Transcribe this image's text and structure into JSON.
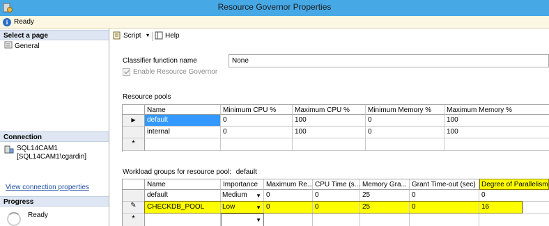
{
  "window": {
    "title": "Resource Governor Properties"
  },
  "status": {
    "text": "Ready"
  },
  "sidebar": {
    "select_page_header": "Select a page",
    "pages": [
      {
        "label": "General"
      }
    ],
    "connection_header": "Connection",
    "connection_server": "SQL14CAM1",
    "connection_user": "[SQL14CAM1\\cgardin]",
    "view_connection_link": "View connection properties",
    "progress_header": "Progress",
    "progress_status": "Ready"
  },
  "toolbar": {
    "script_label": "Script",
    "help_label": "Help"
  },
  "form": {
    "classifier_label": "Classifier function name",
    "classifier_value": "None",
    "enable_label": "Enable Resource Governor",
    "pools_label": "Resource pools",
    "workload_label": "Workload groups for resource pool:",
    "workload_pool_name": "default"
  },
  "pools_grid": {
    "headers": [
      "Name",
      "Minimum CPU %",
      "Maximum CPU %",
      "Minimum Memory %",
      "Maximum Memory %"
    ],
    "rows": [
      [
        "default",
        "0",
        "100",
        "0",
        "100"
      ],
      [
        "internal",
        "0",
        "100",
        "0",
        "100"
      ],
      [
        "",
        "",
        "",
        "",
        ""
      ]
    ],
    "row_markers": [
      "▶",
      "",
      "*"
    ]
  },
  "workload_grid": {
    "headers": [
      "Name",
      "Importance",
      "Maximum Re...",
      "CPU Time (s...",
      "Memory Gra...",
      "Grant Time-out (sec)",
      "Degree of Parallelism"
    ],
    "rows": [
      [
        "default",
        "Medium",
        "0",
        "0",
        "25",
        "0",
        "0"
      ],
      [
        "CHECKDB_POOL",
        "Low",
        "0",
        "0",
        "25",
        "0",
        "16"
      ],
      [
        "",
        "",
        "",
        "",
        "",
        "",
        ""
      ]
    ],
    "row_markers": [
      "",
      "✎",
      "*"
    ]
  },
  "colors": {
    "titlebar": "#47a8e6",
    "selection": "#3399ff",
    "highlight": "#ffff00"
  }
}
